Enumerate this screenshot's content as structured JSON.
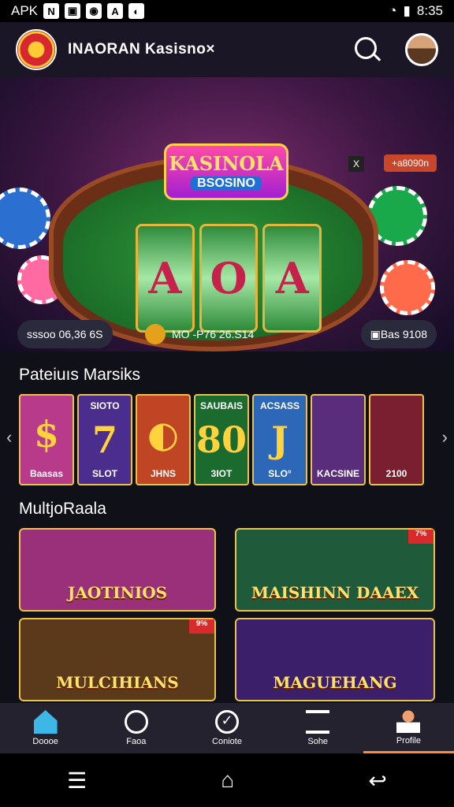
{
  "status": {
    "left": "APK",
    "time": "8:35",
    "left_icons": [
      "N",
      "▣",
      "◉",
      "A",
      "◐"
    ]
  },
  "topbar": {
    "title": "INAORAN Kasisno×"
  },
  "hero": {
    "brand_line1": "KASINOLA",
    "brand_line2": "BSOSINO",
    "reels": [
      "A",
      "O",
      "A"
    ],
    "tag": "+a8090n",
    "x": "X",
    "pill_left": "sssoo 06,36 6S",
    "pill_mid": "MO  -P76 26.S14",
    "pill_right": "Bas 9108"
  },
  "sections": {
    "first_title": "Pateiuıs Marsiks",
    "second_title": "MultjoRaala"
  },
  "carousel": [
    {
      "top": "",
      "big": "$",
      "bottom": "Baasas",
      "bg": "#b83a8a"
    },
    {
      "top": "SIOTO",
      "big": "7",
      "bottom": "SLOT",
      "bg": "#4a2d8c"
    },
    {
      "top": "",
      "big": "◐",
      "bottom": "JHNS",
      "bg": "#c04524"
    },
    {
      "top": "SAUBAIS",
      "big": "80",
      "bottom": "3IOT",
      "bg": "#1b6b2f"
    },
    {
      "top": "ACSASS",
      "big": "J",
      "bottom": "SLO°",
      "bg": "#2d67b7"
    },
    {
      "top": "",
      "big": "",
      "bottom": "KACSINE",
      "bg": "#5a2d7c"
    },
    {
      "top": "",
      "big": "",
      "bottom": "2100",
      "bg": "#7a1f30"
    }
  ],
  "tiles": [
    {
      "label": "JAOTINIOS",
      "badge": "",
      "bg": "#9a2f7a"
    },
    {
      "label": "MAISHINN DAAEX",
      "badge": "7%",
      "bg": "#1f5a3a"
    },
    {
      "label": "MULCIHIANS",
      "badge": "9%",
      "bg": "#5a3a1b"
    },
    {
      "label": "MAGUEHANG",
      "badge": "",
      "bg": "#3b1f6a"
    }
  ],
  "nav": [
    {
      "label": "Doooe"
    },
    {
      "label": "Faoa"
    },
    {
      "label": "Coniote"
    },
    {
      "label": "Sohe"
    },
    {
      "label": "Profile"
    }
  ],
  "sysnav": {
    "recent": "☰",
    "home": "⌂",
    "back": "↩"
  },
  "colors": {
    "accent": "#e8c24a",
    "active": "#ff8a3d"
  }
}
